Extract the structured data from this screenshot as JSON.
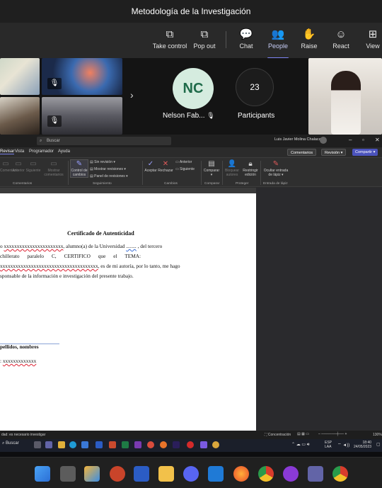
{
  "teams": {
    "title": "Metodología de la Investigación",
    "toolbar": [
      {
        "label": "Take control",
        "icon": "take-control-icon",
        "glyph": "⧉",
        "active": false
      },
      {
        "label": "Pop out",
        "icon": "pop-out-icon",
        "glyph": "⧉",
        "active": false
      },
      {
        "label": "Chat",
        "icon": "chat-icon",
        "glyph": "💬",
        "active": false
      },
      {
        "label": "People",
        "icon": "people-icon",
        "glyph": "👥",
        "active": true
      },
      {
        "label": "Raise",
        "icon": "raise-hand-icon",
        "glyph": "✋",
        "active": false
      },
      {
        "label": "React",
        "icon": "react-icon",
        "glyph": "☺",
        "active": false
      },
      {
        "label": "View",
        "icon": "view-icon",
        "glyph": "⊞",
        "active": false
      }
    ],
    "participants": {
      "nc_initials": "NC",
      "nc_name": "Nelson Fab...",
      "count": "23",
      "count_label": "Participants"
    }
  },
  "word": {
    "search": "Buscar",
    "user": "Luis Javier Molina Chalacan",
    "tabs": [
      "Revisar",
      "Vista",
      "Programador",
      "Ayuda"
    ],
    "pill_comments": "Comentarios",
    "pill_revision": "Revisión",
    "pill_share": "Compartir",
    "ribbon": {
      "comentarios": [
        "Comentario",
        "Anterior",
        "Siguiente",
        "Mostrar comentarios"
      ],
      "seguimiento": [
        "Control de cambios",
        "Sin revisión",
        "Mostrar revisiones",
        "Panel de revisiones"
      ],
      "cambios": [
        "Aceptar",
        "Rechazar",
        "Anterior",
        "Siguiente"
      ],
      "comparar": [
        "Comparar"
      ],
      "proteger": [
        "Bloquear autores",
        "Restringir edición"
      ],
      "lapiz": [
        "Ocultar entrada de lápiz"
      ],
      "groups": [
        "Comentarios",
        "Seguimiento",
        "Cambios",
        "Comparar",
        "Proteger",
        "Entrada de lápiz"
      ]
    },
    "doc": {
      "heading": "Certificado de Autenticidad",
      "p1_a": "o ",
      "p1_x": "xxxxxxxxxxxxxxxxxxxxxxx",
      "p1_b": ", alumno(a) de la Universidad ",
      "p1_dots": "........",
      "p1_c": " , del tercero",
      "p2": "chillerato      paralelo      C,      CERTIFICO      que      el      TEMA:",
      "p3_x": "xxxxxxxxxxxxxxxxxxxxxxxxxxxxxxxxxxxxxx",
      "p3_b": ", es de mi autoría, por lo tanto, me hago",
      "p4": "sponsable de la información e investigación del presente trabajo.",
      "sig": "pellidos, nombres",
      "ci_a": ": ",
      "ci_x": "xxxxxxxxxxxxx"
    },
    "status_left": "dad: es necesario investigar",
    "status_focus": "Concentración",
    "status_zoom": "130%"
  },
  "windows": {
    "search": "Buscar",
    "lang": "ESP",
    "lang2": "LAA",
    "time": "18:40",
    "date": "24/05/2023"
  },
  "colors": {
    "accent": "#7f85f5",
    "teams_bar": "#1f1f1f",
    "word_dark": "#2b2b2b"
  }
}
